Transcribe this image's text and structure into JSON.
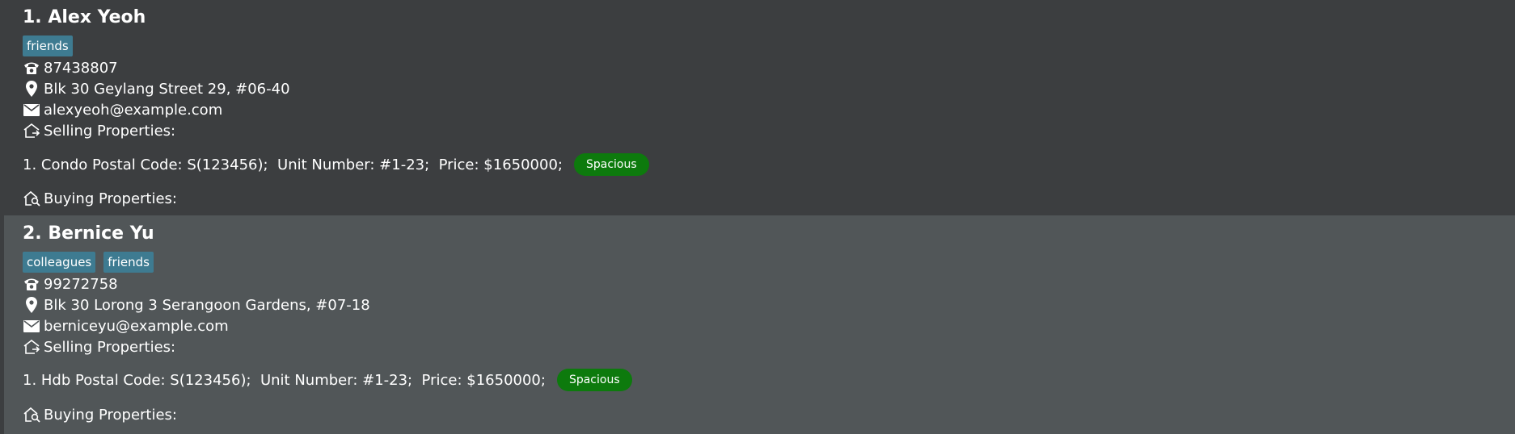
{
  "persons": [
    {
      "name": "1. Alex Yeoh",
      "tags": [
        "friends"
      ],
      "phone": "87438807",
      "address": "Blk 30 Geylang Street 29, #06-40",
      "email": "alexyeoh@example.com",
      "selling_label": "Selling Properties:",
      "selling": [
        {
          "text": "1. Condo Postal Code: S(123456);  Unit Number: #1-23;  Price: $1650000;",
          "tag": "Spacious"
        }
      ],
      "buying_label": "Buying Properties:"
    },
    {
      "name": "2. Bernice Yu",
      "tags": [
        "colleagues",
        "friends"
      ],
      "phone": "99272758",
      "address": "Blk 30 Lorong 3 Serangoon Gardens, #07-18",
      "email": "berniceyu@example.com",
      "selling_label": "Selling Properties:",
      "selling": [
        {
          "text": "1. Hdb Postal Code: S(123456);  Unit Number: #1-23;  Price: $1650000;",
          "tag": "Spacious"
        }
      ],
      "buying_label": "Buying Properties:"
    }
  ],
  "colors": {
    "card_odd": "#3c3e40",
    "card_even": "#515658",
    "tag": "#3e7b91",
    "property_tag": "#0d7a0d"
  },
  "icons": [
    "phone-icon",
    "location-pin-icon",
    "email-icon",
    "house-sell-icon",
    "house-search-icon"
  ]
}
